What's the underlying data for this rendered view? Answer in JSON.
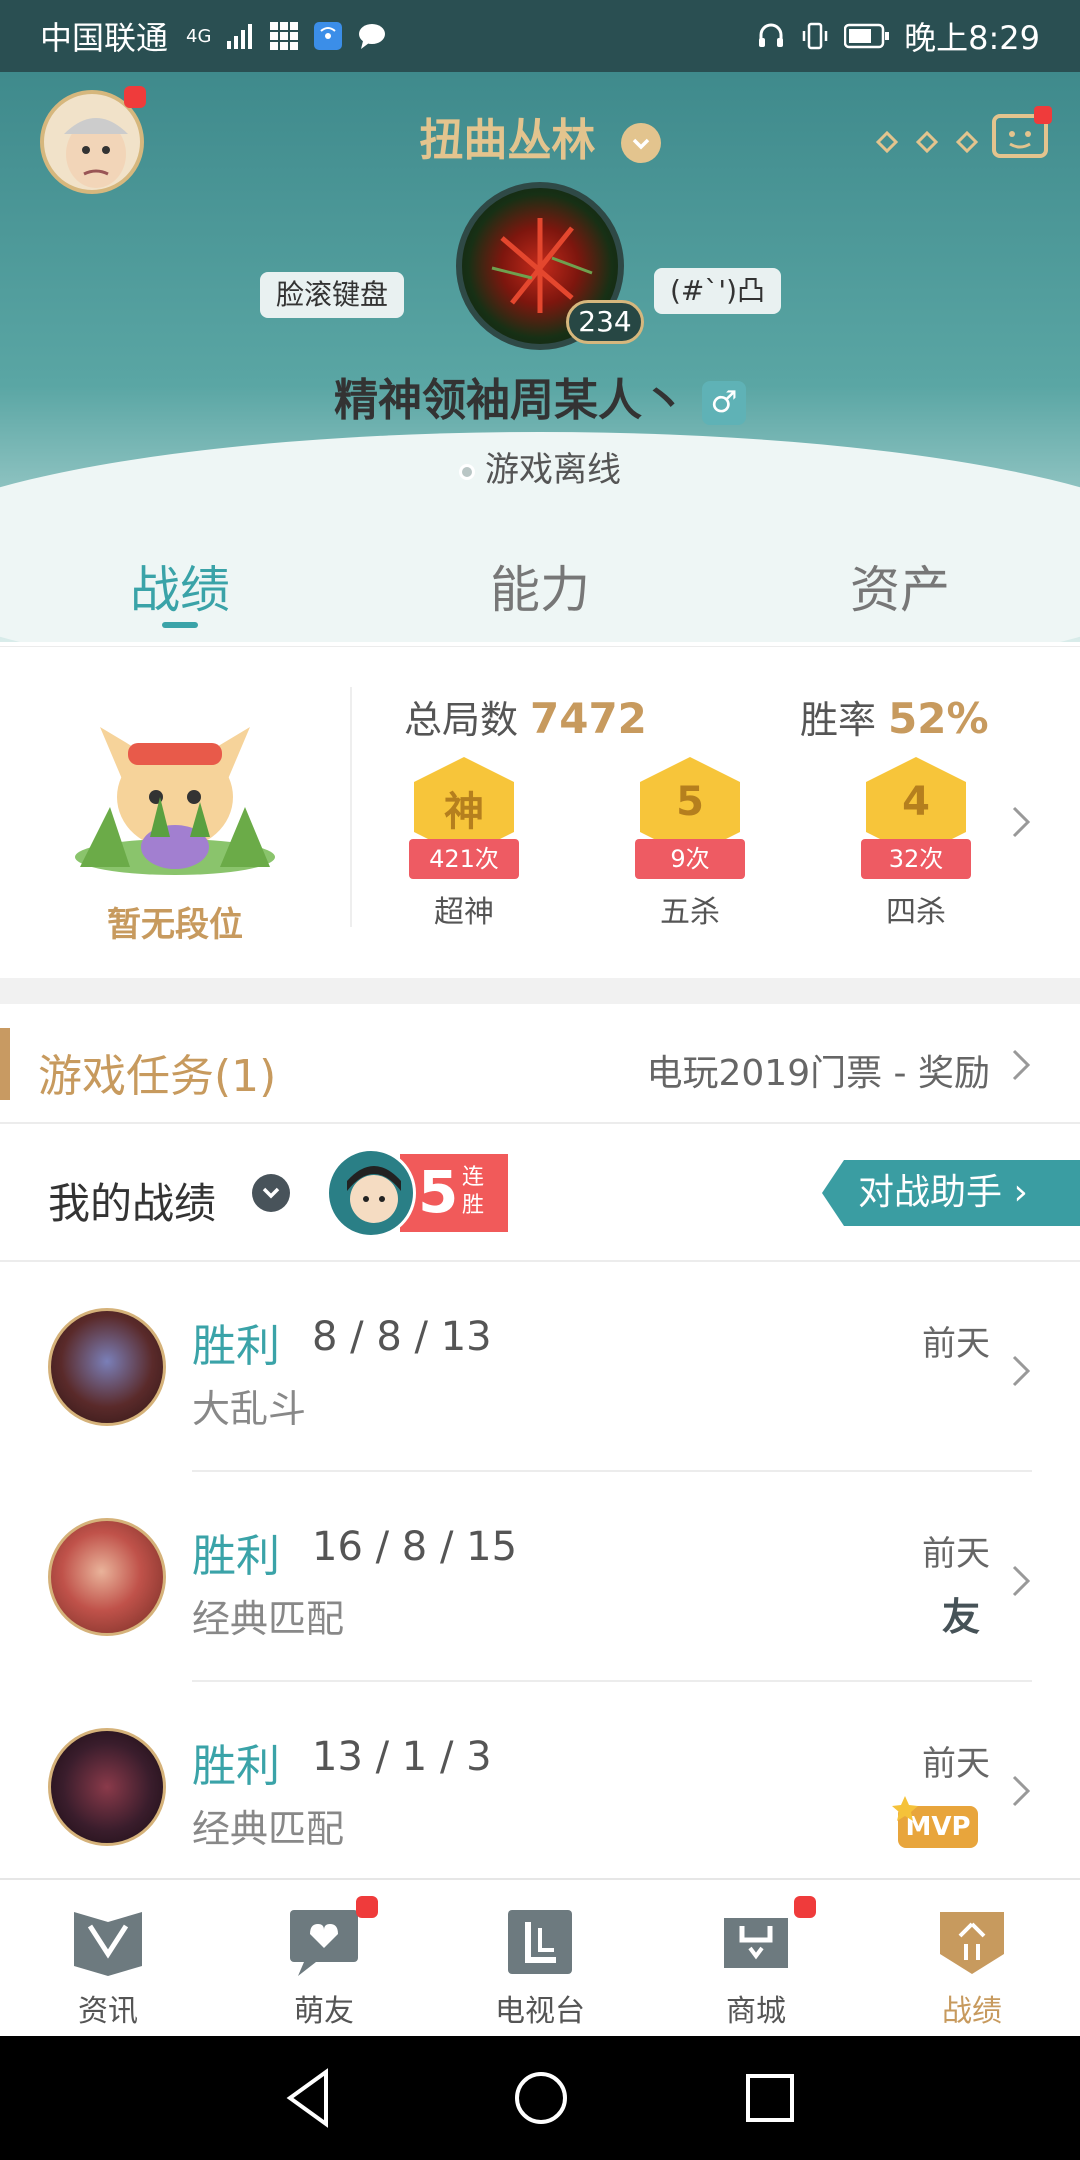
{
  "statusbar": {
    "carrier": "中国联通",
    "network": "4G",
    "time": "晚上8:29"
  },
  "header": {
    "title": "扭曲丛林",
    "tag_left": "脸滚键盘",
    "tag_right": "(#`')凸",
    "level": "234",
    "nickname": "精神领袖周某人丶",
    "gender_symbol": "♂",
    "status": "游戏离线"
  },
  "tabs": [
    {
      "label": "战绩",
      "active": true
    },
    {
      "label": "能力",
      "active": false
    },
    {
      "label": "资产",
      "active": false
    }
  ],
  "summary": {
    "rank_label": "暂无段位",
    "total_label": "总局数",
    "total_value": "7472",
    "winrate_label": "胜率",
    "winrate_value": "52%",
    "medals": [
      {
        "glyph": "神",
        "count": "421次",
        "name": "超神"
      },
      {
        "glyph": "5",
        "count": "9次",
        "name": "五杀"
      },
      {
        "glyph": "4",
        "count": "32次",
        "name": "四杀"
      }
    ]
  },
  "quest": {
    "title": "游戏任务(1)",
    "reward": "电玩2019门票 - 奖励"
  },
  "my_record": {
    "title": "我的战绩",
    "streak_number": "5",
    "streak_text": "连胜",
    "assist_button": "对战助手"
  },
  "matches": [
    {
      "result": "胜利",
      "kda": "8 / 8 / 13",
      "mode": "大乱斗",
      "time": "前天",
      "badge": ""
    },
    {
      "result": "胜利",
      "kda": "16 / 8 / 15",
      "mode": "经典匹配",
      "time": "前天",
      "badge": "友"
    },
    {
      "result": "胜利",
      "kda": "13 / 1 / 3",
      "mode": "经典匹配",
      "time": "前天",
      "badge": "MVP"
    }
  ],
  "nav": [
    {
      "label": "资讯",
      "active": false,
      "dot": false
    },
    {
      "label": "萌友",
      "active": false,
      "dot": true
    },
    {
      "label": "电视台",
      "active": false,
      "dot": false
    },
    {
      "label": "商城",
      "active": false,
      "dot": true
    },
    {
      "label": "战绩",
      "active": true,
      "dot": false
    }
  ],
  "colors": {
    "teal": "#3aa3a8",
    "gold": "#c79a5e",
    "red": "#ef3b3b"
  }
}
